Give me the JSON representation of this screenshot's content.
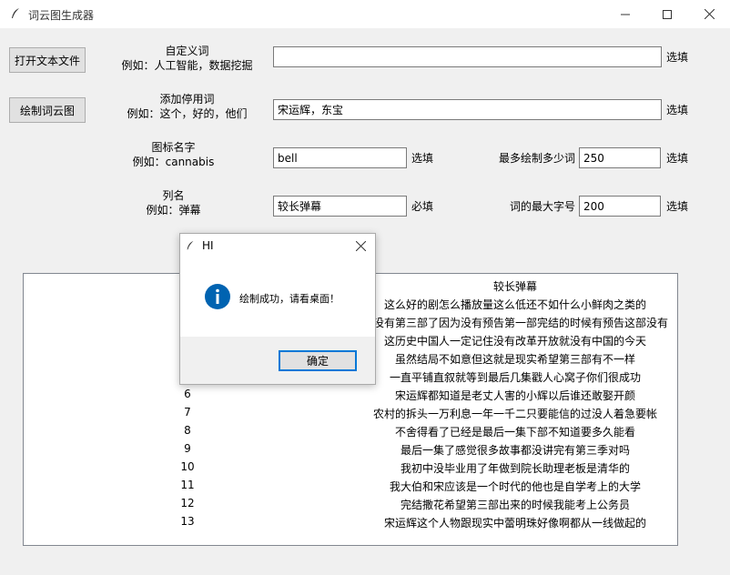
{
  "window": {
    "title": "词云图生成器"
  },
  "buttons": {
    "open_file": "打开文本文件",
    "draw": "绘制词云图"
  },
  "fields": {
    "custom_words": {
      "label_line1": "自定义词",
      "label_line2": "例如：人工智能，数据挖掘",
      "value": "",
      "note": "选填"
    },
    "stop_words": {
      "label_line1": "添加停用词",
      "label_line2": "例如：这个，好的，他们",
      "value": "宋运辉，东宝",
      "note": "选填"
    },
    "icon_name": {
      "label_line1": "图标名字",
      "label_line2": "例如：cannabis",
      "value": "bell",
      "note": "选填"
    },
    "column_name": {
      "label_line1": "列名",
      "label_line2": "例如：弹幕",
      "value": "较长弹幕",
      "note": "必填"
    },
    "max_words": {
      "label": "最多绘制多少词",
      "value": "250",
      "note": "选填"
    },
    "max_font": {
      "label": "词的最大字号",
      "value": "200",
      "note": "选填"
    }
  },
  "table": {
    "header": "较长弹幕",
    "rows": [
      {
        "index": "",
        "text": "这么好的剧怎么播放量这么低还不如什么小鲜肉之类的"
      },
      {
        "index": "",
        "text": "啦没有第三部了因为没有预告第一部完结的时候有预告这部没有"
      },
      {
        "index": "",
        "text": "这历史中国人一定记住没有改革开放就没有中国的今天"
      },
      {
        "index": "",
        "text": "虽然结局不如意但这就是现实希望第三部有不一样"
      },
      {
        "index": "",
        "text": "一直平铺直叙就等到最后几集戳人心窝子你们很成功"
      },
      {
        "index": "6",
        "text": "宋运辉都知道是老丈人害的小辉以后谁还敢娶开颜"
      },
      {
        "index": "7",
        "text": "农村的拆头一万利息一年一千二只要能信的过没人着急要帐"
      },
      {
        "index": "8",
        "text": "不舍得看了已经是最后一集下部不知道要多久能看"
      },
      {
        "index": "9",
        "text": "最后一集了感觉很多故事都没讲完有第三季对吗"
      },
      {
        "index": "10",
        "text": "我初中没毕业用了年做到院长助理老板是清华的"
      },
      {
        "index": "11",
        "text": "我大伯和宋应该是一个时代的他也是自学考上的大学"
      },
      {
        "index": "12",
        "text": "完结撒花希望第三部出来的时候我能考上公务员"
      },
      {
        "index": "13",
        "text": "宋运辉这个人物跟现实中蕾明珠好像啊都从一线做起的"
      }
    ]
  },
  "dialog": {
    "title": "HI",
    "message": "绘制成功，请看桌面！",
    "ok": "确定"
  },
  "colors": {
    "info_icon": "#0063b1",
    "ok_border": "#0078d7"
  }
}
